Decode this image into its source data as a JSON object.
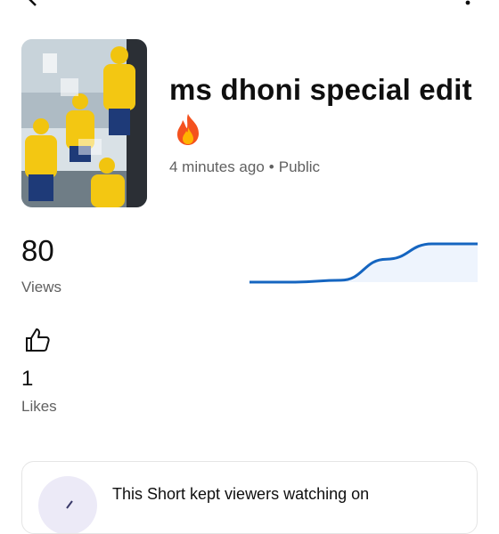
{
  "video": {
    "title": "ms dhoni special edit",
    "title_emoji": "🔥",
    "age": "4 minutes ago",
    "separator": "•",
    "visibility": "Public"
  },
  "stats": {
    "views_count": "80",
    "views_label": "Views",
    "likes_count": "1",
    "likes_label": "Likes"
  },
  "views_trend": {
    "type": "line",
    "values": [
      0,
      0,
      0.05,
      0.6,
      1.0,
      1.0
    ]
  },
  "insight": {
    "text": "This Short kept viewers watching on"
  },
  "icons": {
    "back": "back-arrow-icon",
    "more": "more-vertical-icon",
    "like": "thumbs-up-icon",
    "fire": "fire-icon",
    "insight": "insight-icon"
  },
  "colors": {
    "chart_line": "#1565c0",
    "chart_fill": "#eef4fd",
    "muted_text": "#606060",
    "thumb_yellow": "#f3c712"
  }
}
